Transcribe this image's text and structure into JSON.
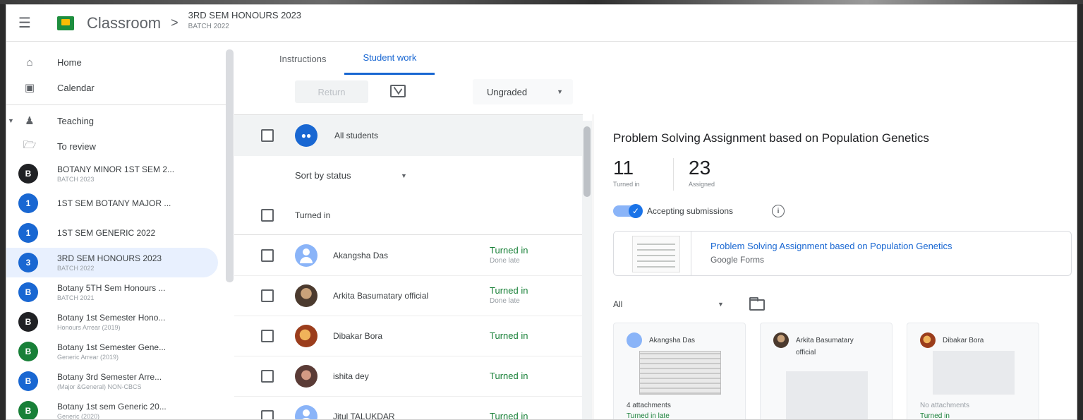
{
  "app": {
    "name": "Classroom",
    "breadcrumb_sep": ">",
    "class_title": "3RD SEM HONOURS 2023",
    "class_subtitle": "BATCH 2022"
  },
  "sidebar": {
    "nav": [
      {
        "label": "Home",
        "icon": "home-icon"
      },
      {
        "label": "Calendar",
        "icon": "calendar-icon"
      }
    ],
    "teaching_label": "Teaching",
    "to_review_label": "To review",
    "classes": [
      {
        "initial": "B",
        "name": "BOTANY MINOR 1ST SEM 2...",
        "sub": "BATCH 2023",
        "color": "#202124"
      },
      {
        "initial": "1",
        "name": "1ST SEM BOTANY MAJOR ...",
        "sub": "",
        "color": "#1967d2"
      },
      {
        "initial": "1",
        "name": "1ST SEM GENERIC 2022",
        "sub": "",
        "color": "#1967d2"
      },
      {
        "initial": "3",
        "name": "3RD SEM HONOURS 2023",
        "sub": "BATCH 2022",
        "color": "#1967d2"
      },
      {
        "initial": "B",
        "name": "Botany 5TH Sem Honours ...",
        "sub": "BATCH 2021",
        "color": "#1967d2"
      },
      {
        "initial": "B",
        "name": "Botany 1st Semester Hono...",
        "sub": "Honours Arrear (2019)",
        "color": "#202124"
      },
      {
        "initial": "B",
        "name": "Botany 1st Semester Gene...",
        "sub": "Generic Arrear (2019)",
        "color": "#188038"
      },
      {
        "initial": "B",
        "name": "Botany 3rd Semester Arre...",
        "sub": "(Major &General) NON-CBCS",
        "color": "#1967d2"
      },
      {
        "initial": "B",
        "name": "Botany 1st sem Generic 20...",
        "sub": "Generic (2020)",
        "color": "#188038"
      }
    ]
  },
  "tabs": [
    {
      "label": "Instructions"
    },
    {
      "label": "Student work"
    }
  ],
  "toolbar": {
    "return_label": "Return",
    "grade_value": "Ungraded"
  },
  "student_list": {
    "all_label": "All students",
    "sort_label": "Sort by status",
    "section_label": "Turned in",
    "students": [
      {
        "name": "Akangsha Das",
        "status": "Turned in",
        "note": "Done late"
      },
      {
        "name": "Arkita Basumatary official",
        "status": "Turned in",
        "note": "Done late"
      },
      {
        "name": "Dibakar Bora",
        "status": "Turned in",
        "note": ""
      },
      {
        "name": "ishita dey",
        "status": "Turned in",
        "note": ""
      },
      {
        "name": "Jitul TALUKDAR",
        "status": "Turned in",
        "note": ""
      }
    ]
  },
  "detail": {
    "title": "Problem Solving Assignment based on Population Genetics",
    "turned_in_count": "11",
    "turned_in_label": "Turned in",
    "assigned_count": "23",
    "assigned_label": "Assigned",
    "accepting_label": "Accepting submissions",
    "attachment_title": "Problem Solving Assignment based on Population Genetics",
    "attachment_type": "Google Forms",
    "filter_label": "All",
    "cards": [
      {
        "name": "Akangsha Das",
        "attach": "4 attachments",
        "status": "Turned in late"
      },
      {
        "name": "Arkita Basumatary official",
        "attach": "",
        "status": ""
      },
      {
        "name": "Dibakar Bora",
        "attach": "No attachments",
        "status": "Turned in"
      }
    ]
  }
}
